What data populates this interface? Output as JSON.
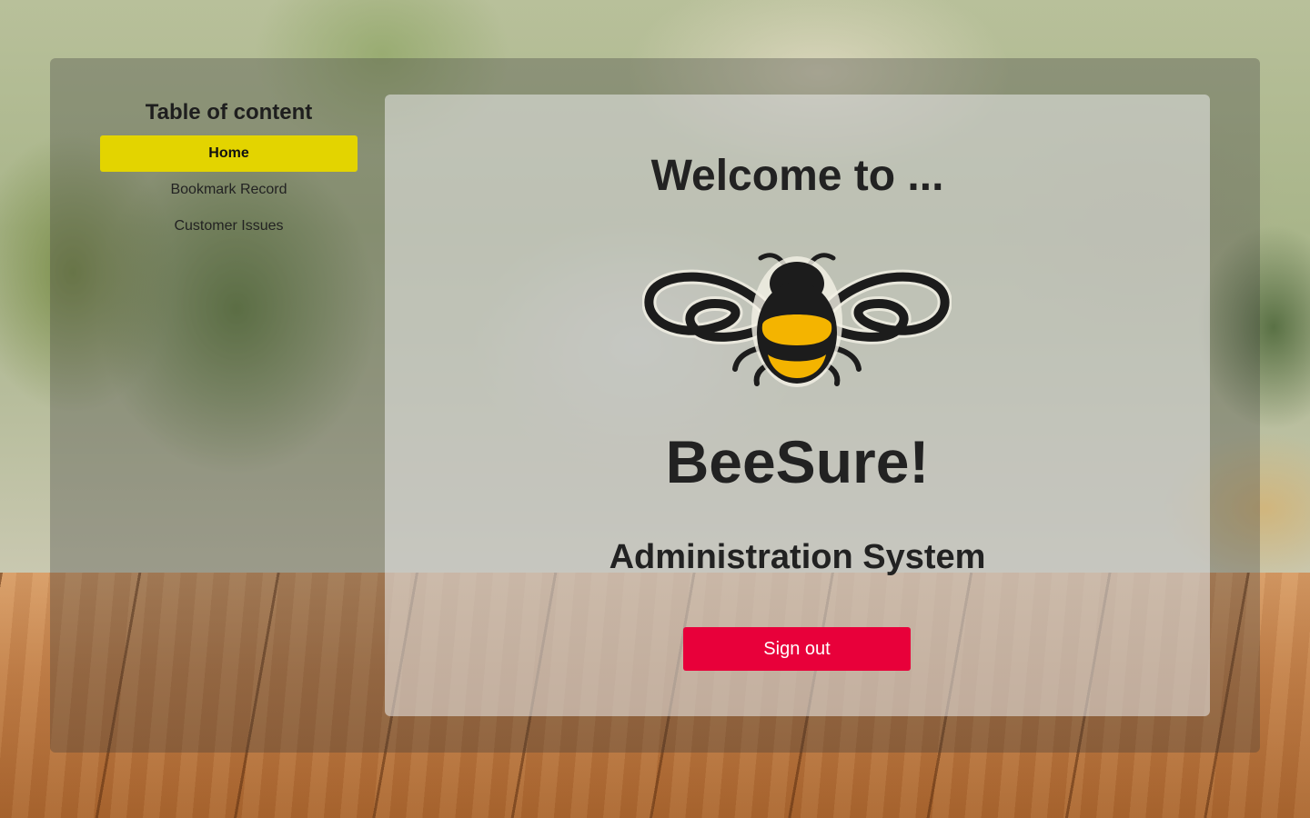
{
  "sidebar": {
    "title": "Table of content",
    "items": [
      {
        "label": "Home",
        "active": true
      },
      {
        "label": "Bookmark Record",
        "active": false
      },
      {
        "label": "Customer Issues",
        "active": false
      }
    ]
  },
  "main": {
    "welcome": "Welcome to ...",
    "logo_icon": "bee-icon",
    "brand": "BeeSure!",
    "subtitle": "Administration System",
    "signout_label": "Sign out"
  },
  "colors": {
    "active_nav": "#e3d400",
    "signout": "#e8003a",
    "bee_yellow": "#f4b400",
    "bee_dark": "#1c1c1c"
  }
}
